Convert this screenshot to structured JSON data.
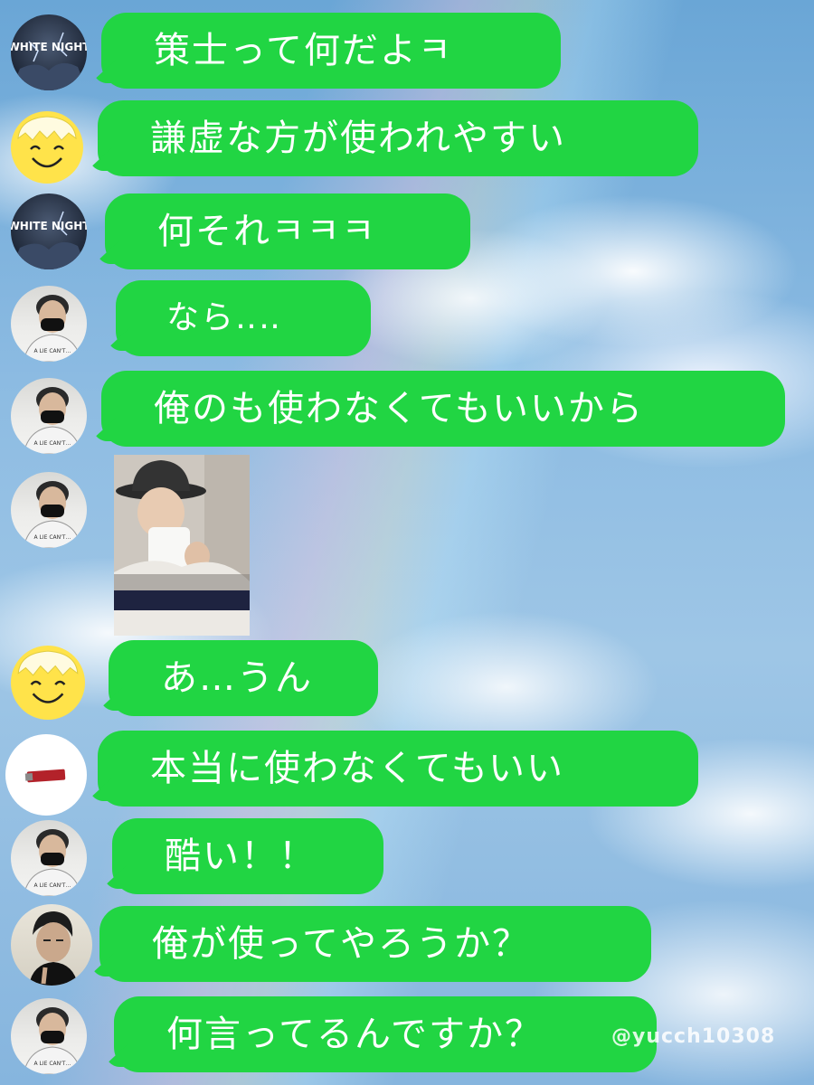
{
  "messages": [
    {
      "sender": "white-night",
      "text": "策士って何だよㅋ"
    },
    {
      "sender": "smiley",
      "text": "謙虚な方が使われやすい"
    },
    {
      "sender": "white-night",
      "text": "何それㅋㅋㅋ"
    },
    {
      "sender": "masked",
      "text": "なら‥‥"
    },
    {
      "sender": "masked",
      "text": "俺のも使わなくてもいいから"
    },
    {
      "sender": "masked",
      "type": "photo"
    },
    {
      "sender": "smiley",
      "text": "あ…うん"
    },
    {
      "sender": "usb",
      "text": "本当に使わなくてもいい"
    },
    {
      "sender": "masked",
      "text": "酷い！！"
    },
    {
      "sender": "top",
      "text": "俺が使ってやろうか？"
    },
    {
      "sender": "masked",
      "text": "何言ってるんですか？"
    }
  ],
  "avatar_texts": {
    "white_night": "WHITE NIGHT",
    "shirt": "A LIE CAN'T…"
  },
  "watermark": "@yucch10308",
  "colors": {
    "bubble": "#21d543",
    "bubble_text": "#ffffff",
    "sky": "#8cbbe2"
  },
  "icons": [
    "white-night-avatar-icon",
    "smiley-avatar-icon",
    "masked-man-avatar-icon",
    "usb-avatar-icon",
    "man-avatar-icon"
  ]
}
